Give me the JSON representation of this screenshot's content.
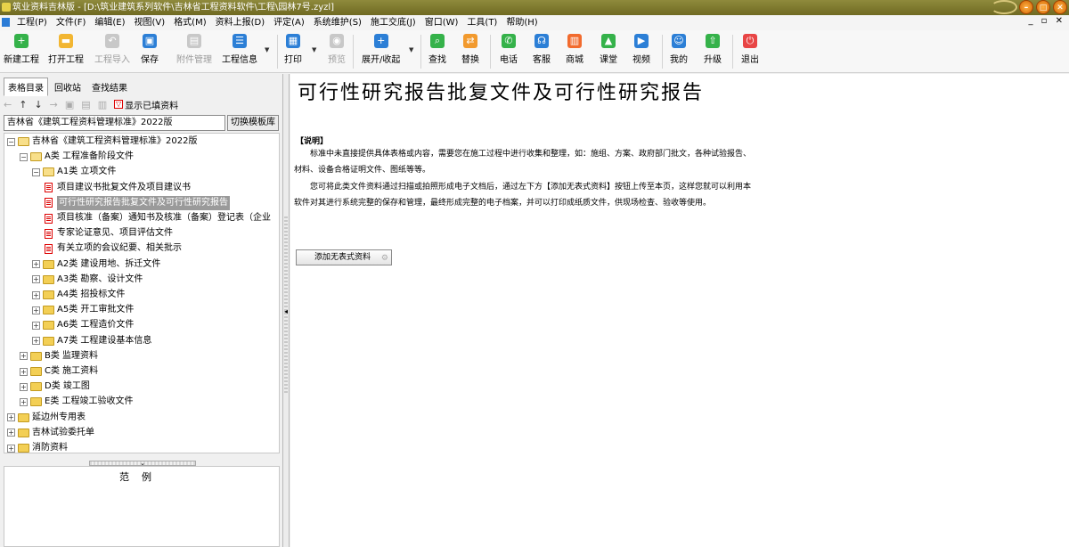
{
  "window": {
    "title": "筑业资料吉林版 - [D:\\筑业建筑系列软件\\吉林省工程资料软件\\工程\\园林7号.zyzl]",
    "controls": [
      "–",
      "□",
      "✕"
    ],
    "mdi_controls": "_ ▫ ✕"
  },
  "menu": [
    "工程(P)",
    "文件(F)",
    "编辑(E)",
    "视图(V)",
    "格式(M)",
    "资料上报(D)",
    "评定(A)",
    "系统维护(S)",
    "施工交底(J)",
    "窗口(W)",
    "工具(T)",
    "帮助(H)"
  ],
  "toolbar": [
    {
      "label": "新建工程",
      "icon": "new-project-icon",
      "glyph": "+",
      "color": "#35b24a",
      "enabled": true
    },
    {
      "label": "打开工程",
      "icon": "open-folder-icon",
      "glyph": "▬",
      "color": "#f2b632",
      "enabled": true
    },
    {
      "label": "工程导入",
      "icon": "import-icon",
      "glyph": "↶",
      "color": "#c8c8c8",
      "enabled": false
    },
    {
      "label": "保存",
      "icon": "save-icon",
      "glyph": "▣",
      "color": "#2c7fd6",
      "enabled": true
    },
    {
      "label": "附件管理",
      "icon": "attachment-icon",
      "glyph": "▤",
      "color": "#c8c8c8",
      "enabled": false
    },
    {
      "label": "工程信息",
      "icon": "project-info-icon",
      "glyph": "☰",
      "color": "#2c7fd6",
      "enabled": true
    },
    {
      "label": "打印",
      "icon": "print-icon",
      "glyph": "▦",
      "color": "#2c7fd6",
      "enabled": true
    },
    {
      "label": "预览",
      "icon": "preview-icon",
      "glyph": "◉",
      "color": "#c8c8c8",
      "enabled": false
    },
    {
      "label": "展开/收起",
      "icon": "expand-collapse-icon",
      "glyph": "+",
      "color": "#2c7fd6",
      "enabled": true
    },
    {
      "label": "查找",
      "icon": "find-icon",
      "glyph": "⌕",
      "color": "#35b24a",
      "enabled": true
    },
    {
      "label": "替换",
      "icon": "replace-icon",
      "glyph": "⇄",
      "color": "#f29a2e",
      "enabled": true
    },
    {
      "label": "电话",
      "icon": "phone-icon",
      "glyph": "✆",
      "color": "#35b24a",
      "enabled": true
    },
    {
      "label": "客服",
      "icon": "headset-icon",
      "glyph": "☊",
      "color": "#2c7fd6",
      "enabled": true
    },
    {
      "label": "商城",
      "icon": "shop-icon",
      "glyph": "▥",
      "color": "#f26b2e",
      "enabled": true
    },
    {
      "label": "课堂",
      "icon": "classroom-icon",
      "glyph": "▲",
      "color": "#35b24a",
      "enabled": true
    },
    {
      "label": "视频",
      "icon": "video-icon",
      "glyph": "▶",
      "color": "#2c7fd6",
      "enabled": true
    },
    {
      "label": "我的",
      "icon": "user-icon",
      "glyph": "☺",
      "color": "#2c7fd6",
      "enabled": true
    },
    {
      "label": "升级",
      "icon": "upgrade-icon",
      "glyph": "⇧",
      "color": "#35b24a",
      "enabled": true
    },
    {
      "label": "退出",
      "icon": "power-icon",
      "glyph": "⏻",
      "color": "#e84545",
      "enabled": true
    }
  ],
  "left": {
    "tabs": [
      "表格目录",
      "回收站",
      "查找结果"
    ],
    "active_tab": 0,
    "show_filled_label": "显示已填资料",
    "standard_value": "吉林省《建筑工程资料管理标准》2022版",
    "switch_template_label": "切换模板库",
    "tree": [
      {
        "label": "吉林省《建筑工程资料管理标准》2022版",
        "level": 0,
        "type": "folder",
        "expanded": true
      },
      {
        "label": "A类 工程准备阶段文件",
        "level": 1,
        "type": "folder",
        "expanded": true
      },
      {
        "label": "A1类 立项文件",
        "level": 2,
        "type": "folder",
        "expanded": true
      },
      {
        "label": "项目建议书批复文件及项目建议书",
        "level": 3,
        "type": "doc"
      },
      {
        "label": "可行性研究报告批复文件及可行性研究报告",
        "level": 3,
        "type": "doc",
        "selected": true
      },
      {
        "label": "项目核准（备案）通知书及核准（备案）登记表（企业",
        "level": 3,
        "type": "doc"
      },
      {
        "label": "专家论证意见、项目评估文件",
        "level": 3,
        "type": "doc"
      },
      {
        "label": "有关立项的会议纪要、相关批示",
        "level": 3,
        "type": "doc"
      },
      {
        "label": "A2类 建设用地、拆迁文件",
        "level": 2,
        "type": "folder",
        "expanded": false
      },
      {
        "label": "A3类 勘察、设计文件",
        "level": 2,
        "type": "folder",
        "expanded": false
      },
      {
        "label": "A4类 招投标文件",
        "level": 2,
        "type": "folder",
        "expanded": false
      },
      {
        "label": "A5类 开工审批文件",
        "level": 2,
        "type": "folder",
        "expanded": false
      },
      {
        "label": "A6类 工程造价文件",
        "level": 2,
        "type": "folder",
        "expanded": false
      },
      {
        "label": "A7类 工程建设基本信息",
        "level": 2,
        "type": "folder",
        "expanded": false
      },
      {
        "label": "B类 监理资料",
        "level": 1,
        "type": "folder",
        "expanded": false
      },
      {
        "label": "C类 施工资料",
        "level": 1,
        "type": "folder",
        "expanded": false
      },
      {
        "label": "D类 竣工图",
        "level": 1,
        "type": "folder",
        "expanded": false
      },
      {
        "label": "E类 工程竣工验收文件",
        "level": 1,
        "type": "folder",
        "expanded": false
      },
      {
        "label": "延边州专用表",
        "level": 0,
        "type": "folder",
        "expanded": false
      },
      {
        "label": "吉林试验委托单",
        "level": 0,
        "type": "folder",
        "expanded": false
      },
      {
        "label": "消防资料",
        "level": 0,
        "type": "folder",
        "expanded": false
      }
    ],
    "legend_title": "范例"
  },
  "content": {
    "title": "可行性研究报告批复文件及可行性研究报告",
    "note_heading": "【说明】",
    "paragraphs": [
      "　　标准中未直接提供具体表格或内容，需要您在施工过程中进行收集和整理，如：施组、方案、政府部门批文，各种试验报告、",
      "材料、设备合格证明文件、图纸等等。",
      "　　您可将此类文件资料通过扫描或拍照形成电子文档后，通过左下方【添加无表式资料】按钮上传至本页，这样您就可以利用本",
      "软件对其进行系统完整的保存和管理，最终形成完整的电子档案，并可以打印成纸质文件，供现场检查、验收等使用。"
    ],
    "add_button_label": "添加无表式资料"
  }
}
